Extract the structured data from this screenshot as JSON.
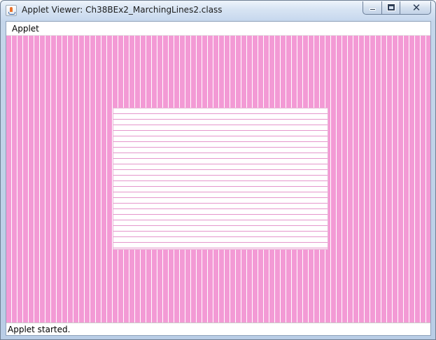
{
  "window": {
    "title": "Applet Viewer: Ch38BEx2_MarchingLines2.class",
    "app_icon": "java-coffee-cup-icon",
    "controls": {
      "minimize_icon": "minimize-icon",
      "maximize_icon": "maximize-icon",
      "close_icon": "close-icon",
      "close_glyph": "✕"
    }
  },
  "menubar": {
    "items": [
      {
        "label": "Applet"
      }
    ]
  },
  "canvas": {
    "outer_color": "#f39ad5",
    "outer_line_color": "#ffffff",
    "inner_color": "#ffffff",
    "inner_line_color": "#e597cc"
  },
  "status": {
    "text": "Applet started."
  }
}
